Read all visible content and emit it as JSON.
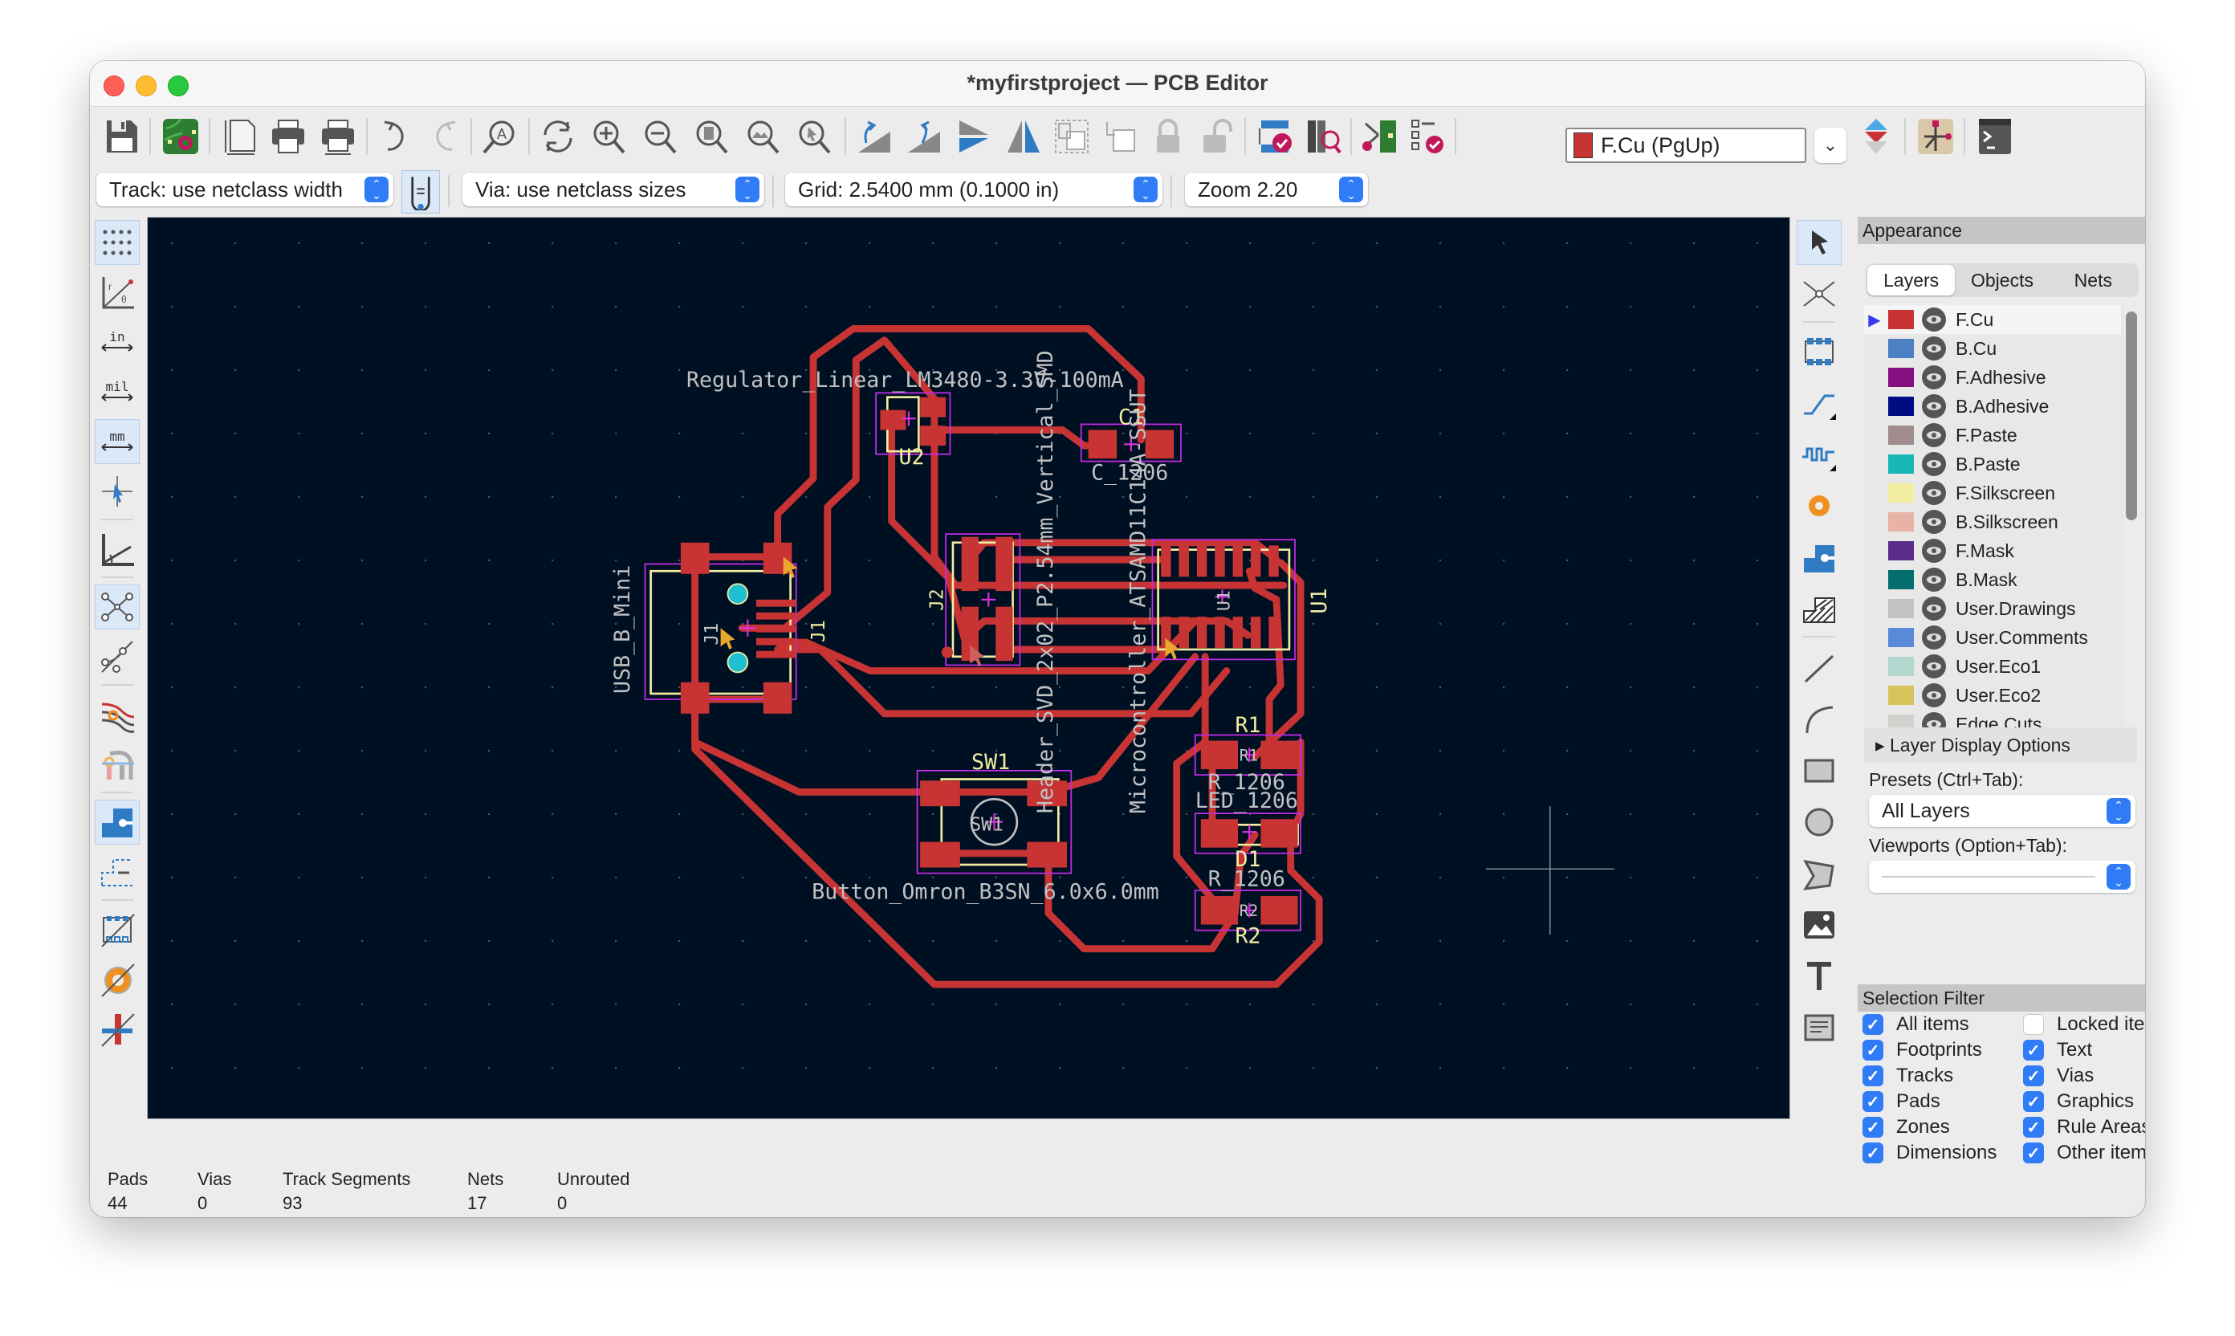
{
  "window": {
    "title": "*myfirstproject — PCB Editor"
  },
  "toolbar": {
    "icons": [
      "save-icon",
      "board-setup-icon",
      "page-settings-icon",
      "print-icon",
      "plot-icon",
      "undo-icon",
      "redo-icon",
      "find-icon",
      "refresh-icon",
      "zoom-in-icon",
      "zoom-out-icon",
      "zoom-fit-icon",
      "zoom-objects-icon",
      "zoom-selection-icon",
      "rotate-ccw-icon",
      "rotate-cw-icon",
      "flip-icon",
      "mirror-icon",
      "group-icon",
      "ungroup-icon",
      "lock-icon",
      "unlock-icon",
      "drc-icon",
      "footprint-browser-icon",
      "update-pcb-icon",
      "inspect-checklist-icon",
      "layer-pair-icon",
      "netlist-icon",
      "scripting-console-icon"
    ],
    "active_layer": "F.Cu (PgUp)",
    "active_layer_color": "#c83434"
  },
  "toolbar2": {
    "track": "Track: use netclass width",
    "via": "Via: use netclass sizes",
    "grid": "Grid: 2.5400 mm (0.1000 in)",
    "zoom": "Zoom 2.20"
  },
  "left_toolbar": [
    "grid-toggle-icon",
    "polar-coords-icon",
    "units-inch-icon",
    "units-mil-icon",
    "units-mm-icon",
    "cursor-crosshair-icon",
    "angle-snap-icon",
    "ratsnest-icon",
    "curved-ratsnest-icon",
    "highlight-net-icon",
    "track-outline-icon",
    "pad-display-icon",
    "via-outline-icon",
    "zone-fill-icon",
    "footprint-outline-icon",
    "graphics-outline-icon"
  ],
  "right_toolbar": [
    "select-icon",
    "local-ratsnest-icon",
    "add-footprint-icon",
    "route-track-icon",
    "tune-length-icon",
    "add-via-icon",
    "add-zone-icon",
    "add-rule-area-icon",
    "draw-line-icon",
    "draw-arc-icon",
    "draw-rectangle-icon",
    "draw-circle-icon",
    "draw-polygon-icon",
    "add-image-icon",
    "add-text-icon",
    "add-textbox-icon"
  ],
  "pcb": {
    "labels": {
      "regulator": "Regulator_Linear_LM3480-3.3V-100mA",
      "u2": "U2",
      "c1": "C1",
      "c1_fp": "C_1206",
      "c1_pad": "C1",
      "header": "Header_SVD_2x02_P2.54mm_Vertical_SMD",
      "micro": "Microcontroller_ATSAMD11C14A-SSUT",
      "usb": "USB_B_Mini",
      "j1": "J1",
      "j1b": "J1",
      "j2": "J2",
      "u1": "U1",
      "u1b": "U1",
      "sw1": "SW1",
      "sw1b": "SW1",
      "button": "Button_Omron_B3SN_6.0x6.0mm",
      "r1": "R1",
      "r1b": "R1",
      "r_1206": "R_1206",
      "led": "LED_1206",
      "d1": "D1",
      "r_1206b": "R_1206",
      "r2": "R2",
      "r2b": "R2"
    },
    "colors": {
      "background": "#001023",
      "copper": "#c83434",
      "silkscreen": "#f2eda1",
      "fab_text": "#c2c2c2",
      "courtyard": "#c22ce8",
      "via_hole": "#1fbfd2"
    }
  },
  "appearance": {
    "title": "Appearance",
    "tabs": [
      "Layers",
      "Objects",
      "Nets"
    ],
    "active_tab": "Layers",
    "layers": [
      {
        "name": "F.Cu",
        "color": "#c83434",
        "selected": true
      },
      {
        "name": "B.Cu",
        "color": "#4d7fc4"
      },
      {
        "name": "F.Adhesive",
        "color": "#84107f"
      },
      {
        "name": "B.Adhesive",
        "color": "#000c84"
      },
      {
        "name": "F.Paste",
        "color": "#a08c8c"
      },
      {
        "name": "B.Paste",
        "color": "#1ab5b5"
      },
      {
        "name": "F.Silkscreen",
        "color": "#f2eda1"
      },
      {
        "name": "B.Silkscreen",
        "color": "#e8b2a6"
      },
      {
        "name": "F.Mask",
        "color": "#5a2d8a"
      },
      {
        "name": "B.Mask",
        "color": "#026e6e"
      },
      {
        "name": "User.Drawings",
        "color": "#c2c2c2"
      },
      {
        "name": "User.Comments",
        "color": "#598ad8"
      },
      {
        "name": "User.Eco1",
        "color": "#b2d8cf"
      },
      {
        "name": "User.Eco2",
        "color": "#d8c35a"
      },
      {
        "name": "Edge.Cuts",
        "color": "#d0d2cd"
      }
    ],
    "layer_display_options": "Layer Display Options",
    "presets_label": "Presets (Ctrl+Tab):",
    "presets_value": "All Layers",
    "viewports_label": "Viewports (Option+Tab):"
  },
  "selection_filter": {
    "title": "Selection Filter",
    "items": [
      {
        "label": "All items",
        "checked": true
      },
      {
        "label": "Locked items",
        "checked": false
      },
      {
        "label": "Footprints",
        "checked": true
      },
      {
        "label": "Text",
        "checked": true
      },
      {
        "label": "Tracks",
        "checked": true
      },
      {
        "label": "Vias",
        "checked": true
      },
      {
        "label": "Pads",
        "checked": true
      },
      {
        "label": "Graphics",
        "checked": true
      },
      {
        "label": "Zones",
        "checked": true
      },
      {
        "label": "Rule Areas",
        "checked": true
      },
      {
        "label": "Dimensions",
        "checked": true
      },
      {
        "label": "Other items",
        "checked": true
      }
    ]
  },
  "status": {
    "pads_label": "Pads",
    "pads": "44",
    "vias_label": "Vias",
    "vias": "0",
    "tracks_label": "Track Segments",
    "tracks": "93",
    "nets_label": "Nets",
    "nets": "17",
    "unrouted_label": "Unrouted",
    "unrouted": "0"
  }
}
